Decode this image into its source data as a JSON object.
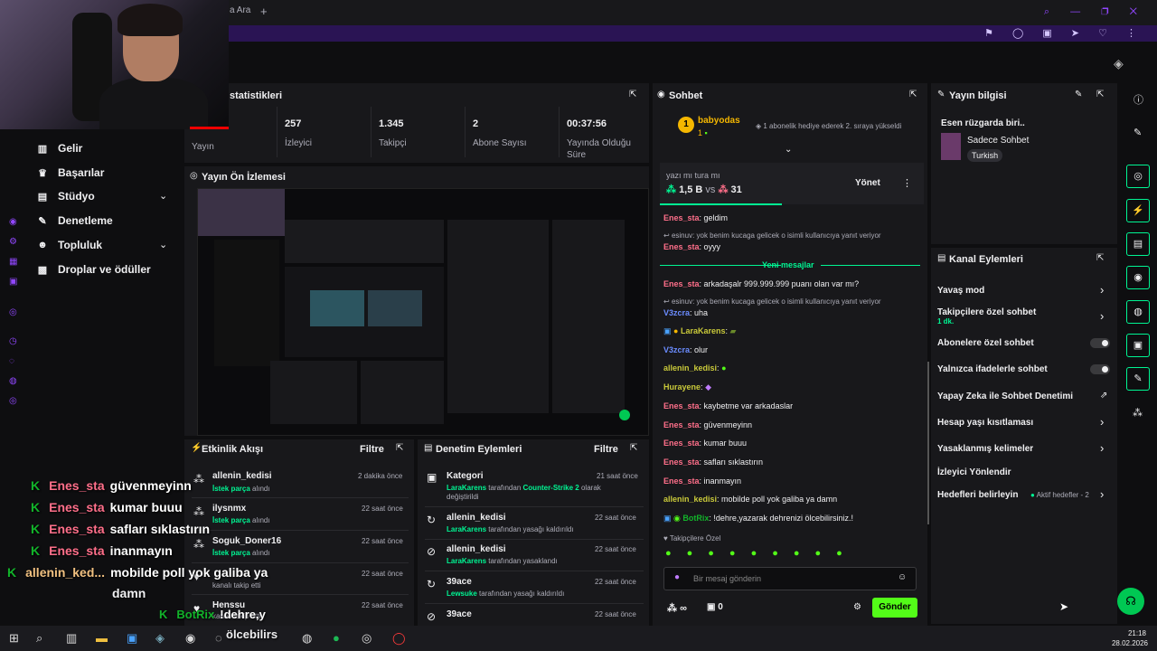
{
  "browser": {
    "tab_title": "a Ara",
    "new_tab": "+"
  },
  "sidebar": {
    "items": [
      {
        "label": "Gelir",
        "icon": "chart-icon"
      },
      {
        "label": "Başarılar",
        "icon": "trophy-icon"
      },
      {
        "label": "Stüdyo",
        "icon": "studio-icon",
        "expandable": true
      },
      {
        "label": "Denetleme",
        "icon": "wrench-icon"
      },
      {
        "label": "Topluluk",
        "icon": "people-icon",
        "expandable": true
      },
      {
        "label": "Droplar ve ödüller",
        "icon": "gift-icon"
      }
    ]
  },
  "stats": {
    "title": "statistikleri",
    "items": [
      {
        "value": "",
        "label": "Yayın"
      },
      {
        "value": "257",
        "label": "İzleyici"
      },
      {
        "value": "1.345",
        "label": "Takipçi"
      },
      {
        "value": "2",
        "label": "Abone Sayısı"
      },
      {
        "value": "00:37:56",
        "label": "Yayında Olduğu Süre"
      }
    ]
  },
  "preview": {
    "title": "Yayın Ön İzlemesi"
  },
  "activity": {
    "title": "Etkinlik Akışı",
    "filter": "Filtre",
    "rows": [
      {
        "name": "allenin_kedisi",
        "desc_strong": "İstek parça",
        "desc": " alındı",
        "time": "2 dakika önce"
      },
      {
        "name": "ilysnmx",
        "desc_strong": "İstek parça",
        "desc": " alındı",
        "time": "22 saat önce"
      },
      {
        "name": "Soguk_Doner16",
        "desc_strong": "İstek parça",
        "desc": " alındı",
        "time": "22 saat önce"
      },
      {
        "name": "",
        "desc_strong": "",
        "desc": "kanalı takip etti",
        "time": "22 saat önce"
      },
      {
        "name": "Henssu",
        "desc_strong": "",
        "desc": "kanalı takip etti",
        "time": "22 saat önce"
      }
    ]
  },
  "moderation": {
    "title": "Denetim Eylemleri",
    "filter": "Filtre",
    "rows": [
      {
        "name": "Kategori",
        "actor": "LaraKarens",
        "desc": " tarafından ",
        "target": "Counter-Strike 2",
        "desc2": " olarak değiştirildi",
        "time": "21 saat önce"
      },
      {
        "name": "allenin_kedisi",
        "actor": "LaraKarens",
        "desc": " tarafından yasağı kaldırıldı",
        "target": "",
        "desc2": "",
        "time": "22 saat önce"
      },
      {
        "name": "allenin_kedisi",
        "actor": "LaraKarens",
        "desc": " tarafından yasaklandı",
        "target": "",
        "desc2": "",
        "time": "22 saat önce"
      },
      {
        "name": "39ace",
        "actor": "Lewsuke",
        "desc": " tarafından yasağı kaldırıldı",
        "target": "",
        "desc2": "",
        "time": "22 saat önce"
      },
      {
        "name": "39ace",
        "actor": "",
        "desc": "",
        "target": "",
        "desc2": "",
        "time": "22 saat önce"
      }
    ]
  },
  "chat": {
    "title": "Sohbet",
    "top_user": "babyodas",
    "top_user_rank": "1",
    "hype_text": "1 abonelik hediye ederek 2. sıraya yükseldi",
    "poll_question": "yazı mı tura mı",
    "poll_left": "1,5 B",
    "poll_vs": "vs",
    "poll_right": "31",
    "manage": "Yönet",
    "new_messages": "Yeni mesajlar",
    "messages": [
      {
        "user": "Enes_sta",
        "color": "#ff6f8a",
        "text": ": geldim"
      },
      {
        "reply": "esinuv: yok benim kucaga gelicek o isimli kullanıcıya yanıt veriyor"
      },
      {
        "user": "Enes_sta",
        "color": "#ff6f8a",
        "text": ": oyyy"
      },
      {
        "user": "Enes_sta",
        "color": "#ff6f8a",
        "text": ": arkadaşalr 999.999.999 puanı olan var mı?"
      },
      {
        "reply": "esinuv: yok benim kucaga gelicek o isimli kullanıcıya yanıt veriyor"
      },
      {
        "user": "V3zcra",
        "color": "#6b8cff",
        "text": ": uha"
      },
      {
        "user": "LaraKarens",
        "color": "#c9c93a",
        "text": ":"
      },
      {
        "user": "V3zcra",
        "color": "#6b8cff",
        "text": ": olur"
      },
      {
        "user": "allenin_kedisi",
        "color": "#c9c93a",
        "text": ":"
      },
      {
        "user": "Hurayene",
        "color": "#c9c93a",
        "text": ":"
      },
      {
        "user": "Enes_sta",
        "color": "#ff6f8a",
        "text": ": kaybetme var arkadaslar"
      },
      {
        "user": "Enes_sta",
        "color": "#ff6f8a",
        "text": ": güvenmeyinn"
      },
      {
        "user": "Enes_sta",
        "color": "#ff6f8a",
        "text": ": kumar buuu"
      },
      {
        "user": "Enes_sta",
        "color": "#ff6f8a",
        "text": ": safları sıklastırın"
      },
      {
        "user": "Enes_sta",
        "color": "#ff6f8a",
        "text": ": inanmayın"
      },
      {
        "user": "allenin_kedisi",
        "color": "#c9c93a",
        "text": ": mobilde poll yok galiba ya damn"
      },
      {
        "user": "BotRix",
        "color": "#12b32a",
        "text": ": !dehre,yazarak dehrenizi ölcebilirsiniz.!"
      }
    ],
    "followers_only": "Takipçilere Özel",
    "input_placeholder": "Bir mesaj gönderin",
    "points": "∞",
    "count": "0",
    "send": "Gönder"
  },
  "stream_info": {
    "title": "Yayın bilgisi",
    "stream_title": "Esen rüzgarda biri..",
    "category": "Sadece Sohbet",
    "tag": "Turkish"
  },
  "channel_actions": {
    "title": "Kanal Eylemleri",
    "items": [
      {
        "label": "Yavaş mod",
        "type": "arrow",
        "sub": ""
      },
      {
        "label": "Takipçilere özel sohbet",
        "type": "arrow",
        "sub": "1 dk."
      },
      {
        "label": "Abonelere özel sohbet",
        "type": "toggle",
        "sub": ""
      },
      {
        "label": "Yalnızca ifadelerle sohbet",
        "type": "toggle",
        "sub": ""
      },
      {
        "label": "Yapay Zeka ile Sohbet Denetimi",
        "type": "external",
        "sub": ""
      },
      {
        "label": "Hesap yaşı kısıtlaması",
        "type": "arrow",
        "sub": ""
      },
      {
        "label": "Yasaklanmış kelimeler",
        "type": "arrow",
        "sub": ""
      },
      {
        "label": "İzleyici Yönlendir",
        "type": "none",
        "sub": ""
      },
      {
        "label": "Hedefleri belirleyin",
        "type": "arrow",
        "sub": "",
        "extra": "Aktif hedefler - 2"
      }
    ]
  },
  "overlay": {
    "lines": [
      {
        "user": "Enes_sta",
        "msg": "güvenmeyinn"
      },
      {
        "user": "Enes_sta",
        "msg": "kumar buuu"
      },
      {
        "user": "Enes_sta",
        "msg": "safları sıklastırın"
      },
      {
        "user": "Enes_sta",
        "msg": "inanmayın"
      },
      {
        "user": "allenin_ked...",
        "msg": "mobilde poll yok galiba ya"
      }
    ],
    "continuation": "damn",
    "bot_user": "BotRix",
    "bot_msg": "!dehre,y",
    "bot_msg2": "ölcebilirs"
  },
  "taskbar": {
    "time": "21:18",
    "date": "28.02.2026"
  },
  "colors": {
    "accent": "#9147ff",
    "green": "#00f593",
    "kick_green": "#53fc18",
    "bg": "#0e0e10",
    "panel": "#18181b"
  }
}
